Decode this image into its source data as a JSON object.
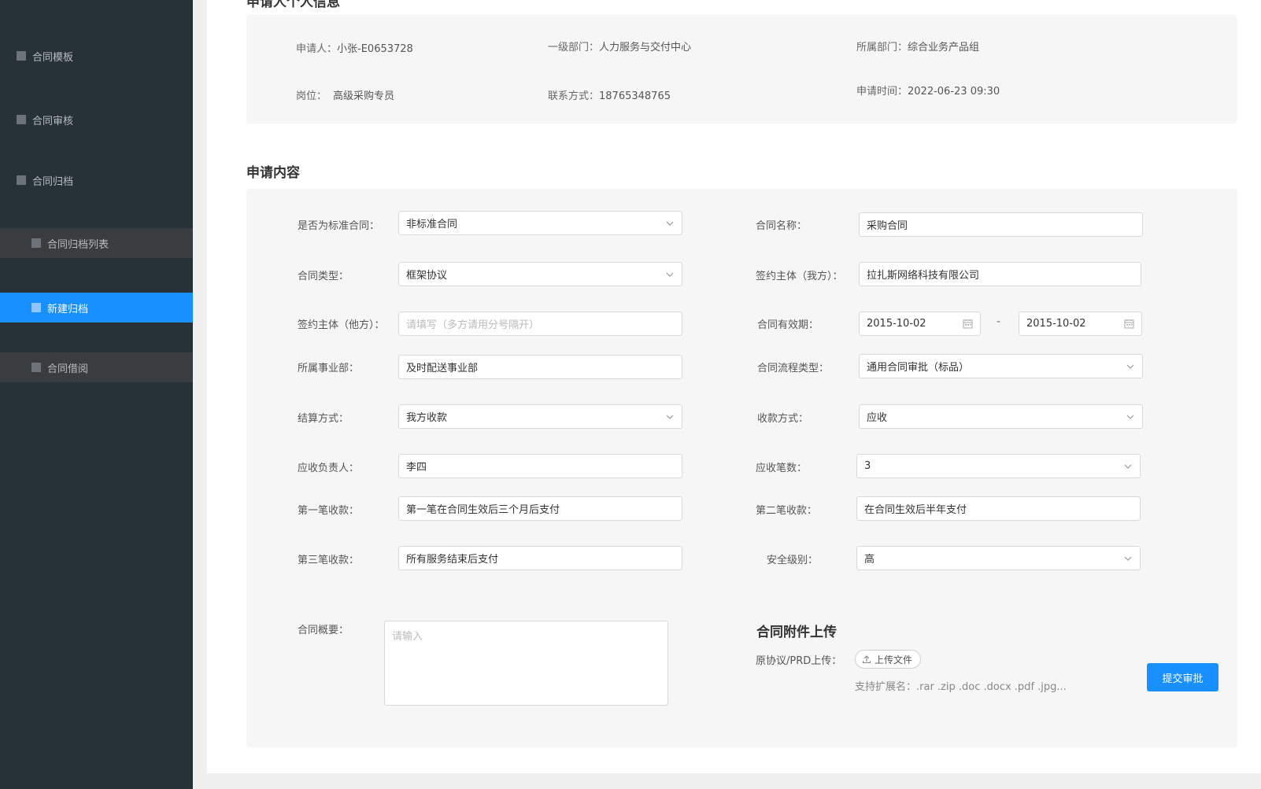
{
  "sidebar": {
    "items": [
      {
        "label": "合同模板"
      },
      {
        "label": "合同审核"
      },
      {
        "label": "合同归档"
      },
      {
        "label": "合同归档列表"
      },
      {
        "label": "新建归档"
      },
      {
        "label": "合同借阅"
      }
    ]
  },
  "personal_info": {
    "title": "申请人个人信息",
    "applicant": {
      "label": "申请人：",
      "value": "小张-E0653728"
    },
    "dept1": {
      "label": "一级部门：",
      "value": "人力服务与交付中心"
    },
    "dept": {
      "label": "所属部门：",
      "value": "综合业务产品组"
    },
    "position": {
      "label": "岗位：",
      "value": "高级采购专员"
    },
    "contact": {
      "label": "联系方式：",
      "value": "18765348765"
    },
    "time": {
      "label": "申请时间：",
      "value": "2022-06-23 09:30"
    }
  },
  "content": {
    "title": "申请内容",
    "is_standard": {
      "label": "是否为标准合同：",
      "value": "非标准合同"
    },
    "contract_name": {
      "label": "合同名称：",
      "value": "采购合同"
    },
    "contract_type": {
      "label": "合同类型：",
      "value": "框架协议"
    },
    "party_self": {
      "label": "签约主体（我方）：",
      "value": "拉扎斯网络科技有限公司"
    },
    "party_other": {
      "label": "签约主体（他方）：",
      "placeholder": "请填写（多方请用分号隔开）"
    },
    "validity": {
      "label": "合同有效期：",
      "start": "2015-10-02",
      "sep": "-",
      "end": "2015-10-02"
    },
    "business_unit": {
      "label": "所属事业部：",
      "value": "及时配送事业部"
    },
    "flow_type": {
      "label": "合同流程类型：",
      "value": "通用合同审批（标品）"
    },
    "settlement": {
      "label": "结算方式：",
      "value": "我方收款"
    },
    "collection": {
      "label": "收款方式：",
      "value": "应收"
    },
    "receivable_owner": {
      "label": "应收负责人：",
      "value": "李四"
    },
    "receivable_count": {
      "label": "应收笔数：",
      "value": "3"
    },
    "first_payment": {
      "label": "第一笔收款：",
      "value": "第一笔在合同生效后三个月后支付"
    },
    "second_payment": {
      "label": "第二笔收款：",
      "value": "在合同生效后半年支付"
    },
    "third_payment": {
      "label": "第三笔收款：",
      "value": "所有服务结束后支付"
    },
    "security_level": {
      "label": "安全级别：",
      "value": "高"
    },
    "summary": {
      "label": "合同概要：",
      "placeholder": "请输入"
    }
  },
  "attachment": {
    "title": "合同附件上传",
    "label": "原协议/PRD上传：",
    "button": "上传文件",
    "hint": "支持扩展名：.rar .zip .doc .docx .pdf .jpg..."
  },
  "submit": {
    "label": "提交审批"
  },
  "colors": {
    "sidebar": "#263238",
    "accent": "#1890ff",
    "panel": "#f6f6f6"
  }
}
